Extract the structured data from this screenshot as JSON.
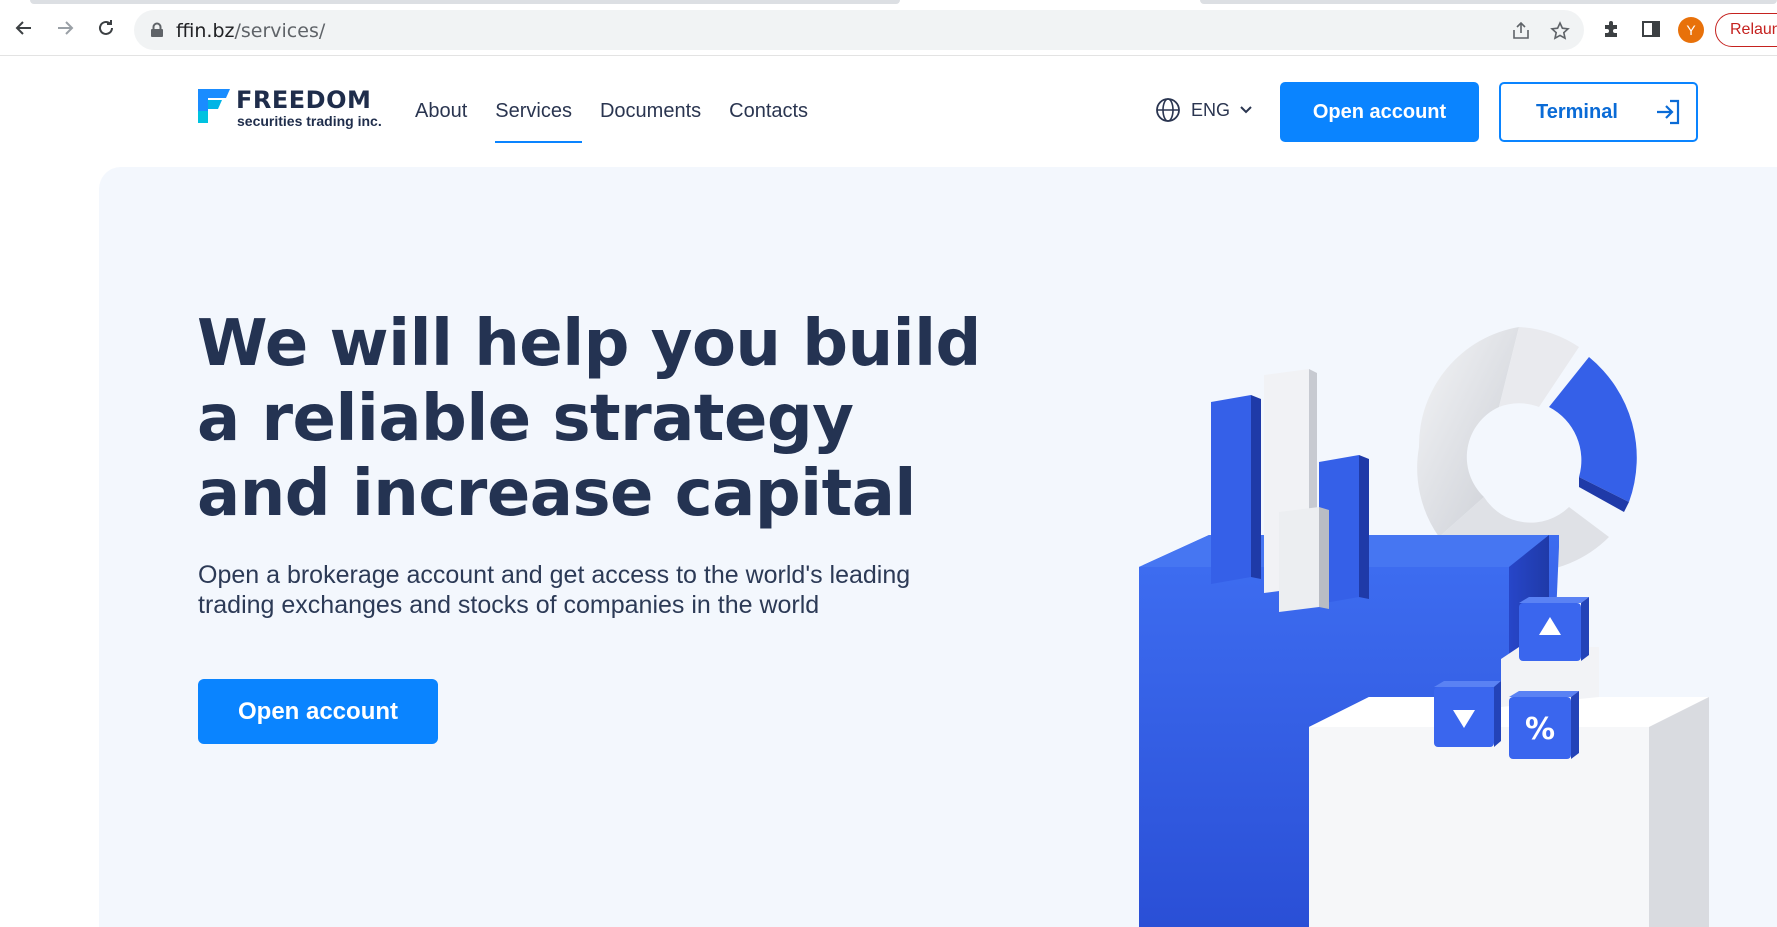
{
  "browser": {
    "url_domain": "ffin.bz",
    "url_path": "/services/",
    "avatar_initial": "Y",
    "relaunch_label": "Relaun",
    "icons": [
      "back-icon",
      "forward-icon",
      "reload-icon",
      "lock-icon",
      "share-icon",
      "bookmark-star-icon",
      "extensions-icon",
      "side-panel-icon"
    ]
  },
  "header": {
    "logo_title": "FREEDOM",
    "logo_subtitle": "securities trading inc.",
    "nav": [
      {
        "label": "About"
      },
      {
        "label": "Services",
        "active": true
      },
      {
        "label": "Documents"
      },
      {
        "label": "Contacts"
      }
    ],
    "language": "ENG",
    "open_account_label": "Open account",
    "terminal_label": "Terminal"
  },
  "hero": {
    "title": "We will help you build a reliable strategy and increase capital",
    "subtitle": "Open a brokerage account and get access to the world's leading trading exchanges and stocks of companies in the world",
    "cta_label": "Open account"
  },
  "colors": {
    "primary": "#0a84ff",
    "heading": "#243352",
    "hero_bg": "#f3f7fd",
    "illustration_blue": "#2f5be0"
  }
}
